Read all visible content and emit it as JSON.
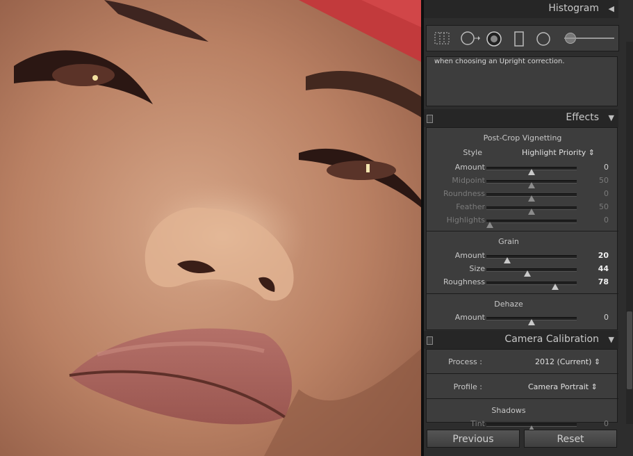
{
  "panels": {
    "histogram": {
      "title": "Histogram",
      "toggle": "◀"
    },
    "lens_note": "when choosing an Upright correction.",
    "effects": {
      "title": "Effects",
      "toggle": "▼",
      "vignetting": {
        "title": "Post-Crop Vignetting",
        "style_label": "Style",
        "style_value": "Highlight Priority ⇕",
        "sliders": [
          {
            "label": "Amount",
            "value": "0",
            "pos": 0.5
          },
          {
            "label": "Midpoint",
            "value": "50",
            "pos": 0.5
          },
          {
            "label": "Roundness",
            "value": "0",
            "pos": 0.5
          },
          {
            "label": "Feather",
            "value": "50",
            "pos": 0.5
          },
          {
            "label": "Highlights",
            "value": "0",
            "pos": 0.04
          }
        ]
      },
      "grain": {
        "title": "Grain",
        "sliders": [
          {
            "label": "Amount",
            "value": "20",
            "pos": 0.23
          },
          {
            "label": "Size",
            "value": "44",
            "pos": 0.45
          },
          {
            "label": "Roughness",
            "value": "78",
            "pos": 0.76
          }
        ]
      },
      "dehaze": {
        "title": "Dehaze",
        "sliders": [
          {
            "label": "Amount",
            "value": "0",
            "pos": 0.5
          }
        ]
      }
    },
    "camera_calibration": {
      "title": "Camera Calibration",
      "toggle": "▼",
      "process_label": "Process :",
      "process_value": "2012 (Current) ⇕",
      "profile_label": "Profile :",
      "profile_value": "Camera Portrait ⇕",
      "shadows_title": "Shadows",
      "tint_label": "Tint",
      "tint_value": "0"
    }
  },
  "buttons": {
    "previous": "Previous",
    "reset": "Reset"
  },
  "colors": {
    "panel_bg": "#2d2d2d",
    "section_bg": "#3d3d3d",
    "photo_backdrop": "#c23a3c"
  }
}
